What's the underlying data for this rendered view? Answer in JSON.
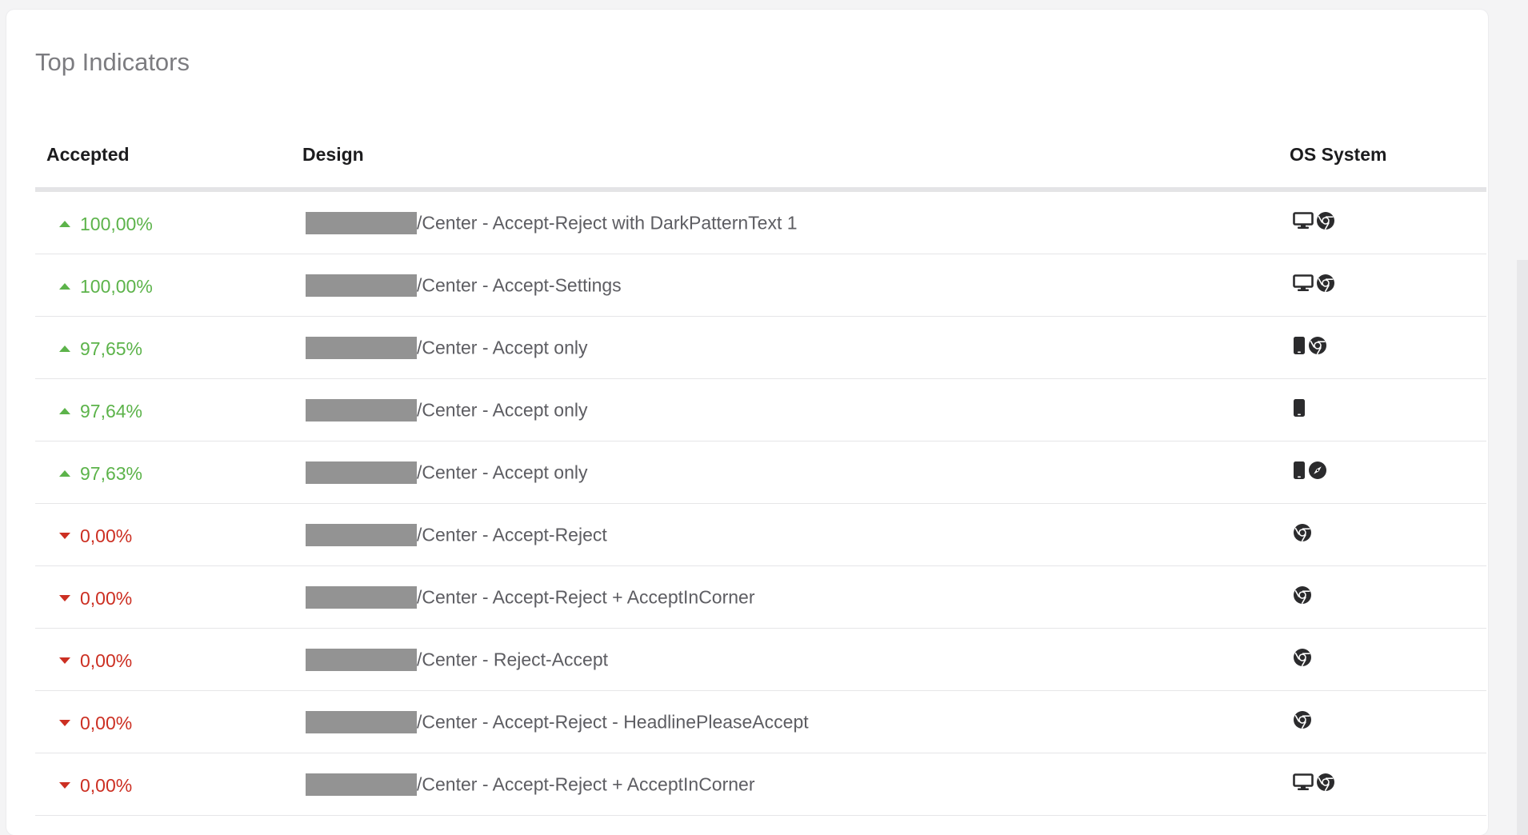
{
  "title": "Top Indicators",
  "columns": {
    "accepted": "Accepted",
    "design": "Design",
    "os": "OS System"
  },
  "rows": [
    {
      "accepted": "100,00%",
      "trend": "up",
      "design": "/Center - Accept-Reject with DarkPatternText 1",
      "os": [
        "desktop",
        "chrome"
      ]
    },
    {
      "accepted": "100,00%",
      "trend": "up",
      "design": "/Center - Accept-Settings",
      "os": [
        "desktop",
        "chrome"
      ]
    },
    {
      "accepted": "97,65%",
      "trend": "up",
      "design": "/Center - Accept only",
      "os": [
        "mobile",
        "chrome"
      ]
    },
    {
      "accepted": "97,64%",
      "trend": "up",
      "design": "/Center - Accept only",
      "os": [
        "mobile"
      ]
    },
    {
      "accepted": "97,63%",
      "trend": "up",
      "design": "/Center - Accept only",
      "os": [
        "mobile",
        "safari"
      ]
    },
    {
      "accepted": "0,00%",
      "trend": "down",
      "design": "/Center - Accept-Reject",
      "os": [
        "chrome"
      ]
    },
    {
      "accepted": "0,00%",
      "trend": "down",
      "design": "/Center - Accept-Reject + AcceptInCorner",
      "os": [
        "chrome"
      ]
    },
    {
      "accepted": "0,00%",
      "trend": "down",
      "design": "/Center - Reject-Accept",
      "os": [
        "chrome"
      ]
    },
    {
      "accepted": "0,00%",
      "trend": "down",
      "design": "/Center - Accept-Reject - HeadlinePleaseAccept",
      "os": [
        "chrome"
      ]
    },
    {
      "accepted": "0,00%",
      "trend": "down",
      "design": "/Center - Accept-Reject + AcceptInCorner",
      "os": [
        "desktop",
        "chrome"
      ]
    }
  ],
  "colors": {
    "up": "#5cb34a",
    "down": "#cc2f22",
    "redaction": "#939393"
  },
  "icons": {
    "desktop": "desktop-icon",
    "mobile": "mobile-icon",
    "chrome": "chrome-icon",
    "safari": "safari-icon",
    "up": "triangle-up-icon",
    "down": "triangle-down-icon"
  }
}
